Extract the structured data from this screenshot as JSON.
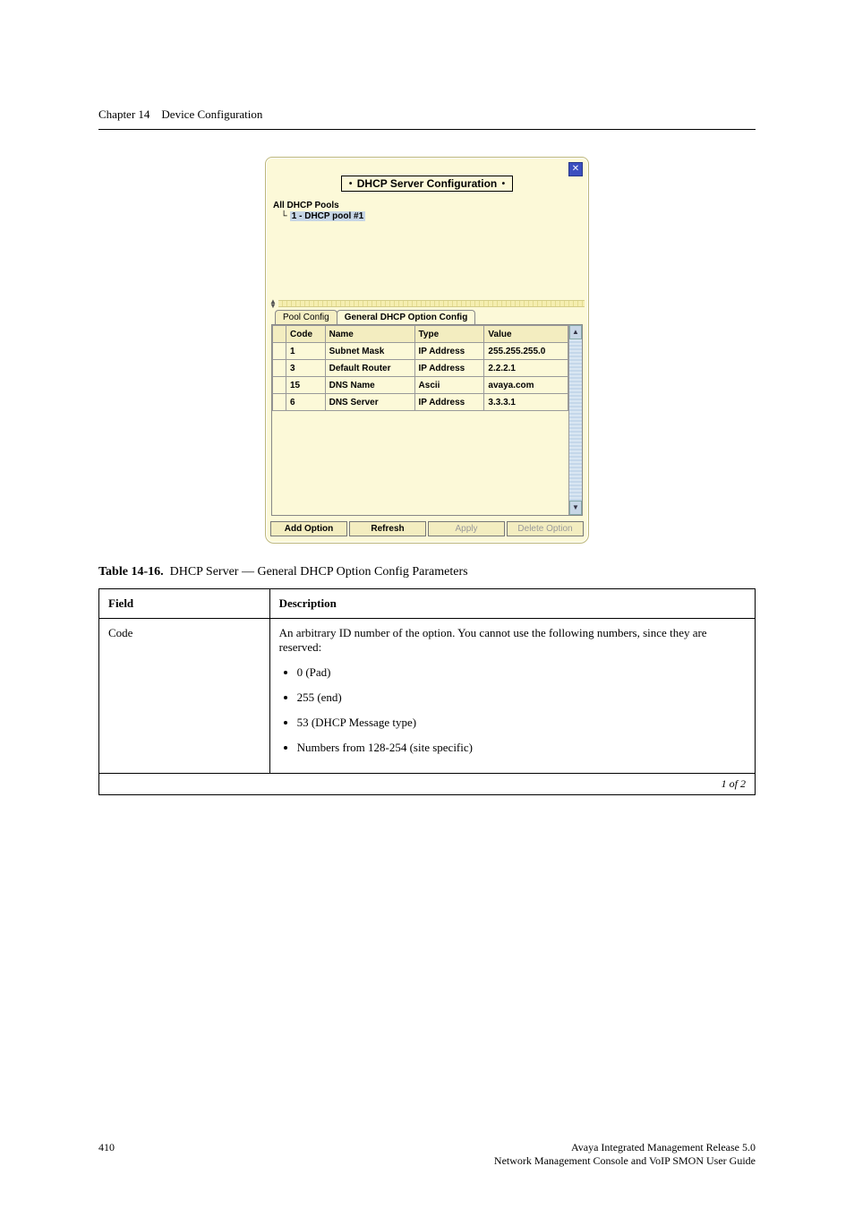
{
  "header": {
    "chapter_label": "Chapter 14",
    "chapter_title": "Device Configuration"
  },
  "screenshot": {
    "close_glyph": "✕",
    "title_core": "DHCP Server Configuration",
    "tree": {
      "root": "All DHCP Pools",
      "child": "1 - DHCP pool #1"
    },
    "tabs": {
      "pool": "Pool Config",
      "general": "General DHCP Option Config"
    },
    "columns": {
      "sel": "",
      "code": "Code",
      "name": "Name",
      "type": "Type",
      "value": "Value"
    },
    "rows": [
      {
        "code": "1",
        "name": "Subnet Mask",
        "type": "IP Address",
        "value": "255.255.255.0"
      },
      {
        "code": "3",
        "name": "Default Router",
        "type": "IP Address",
        "value": "2.2.2.1"
      },
      {
        "code": "15",
        "name": "DNS Name",
        "type": "Ascii",
        "value": "avaya.com"
      },
      {
        "code": "6",
        "name": "DNS Server",
        "type": "IP Address",
        "value": "3.3.3.1"
      }
    ],
    "buttons": {
      "add": "Add Option",
      "refresh": "Refresh",
      "apply": "Apply",
      "delete": "Delete Option"
    }
  },
  "table": {
    "caption_strong": "Table 14-16.",
    "caption_rest": "DHCP Server — General DHCP Option Config Parameters",
    "head": {
      "field": "Field",
      "desc": "Description"
    },
    "row_field": "Code",
    "row_desc_intro": "An arbitrary ID number of the option. You cannot use the following numbers, since they are reserved:",
    "row_desc_items": [
      "0 (Pad)",
      "255 (end)",
      "53 (DHCP Message type)",
      "Numbers from 128-254 (site specific)"
    ],
    "continued": "1 of 2"
  },
  "footer": {
    "page": "410",
    "doc_left": "Avaya Integrated Management Release 5.0",
    "doc_right": "Network Management Console and VoIP SMON User Guide"
  }
}
